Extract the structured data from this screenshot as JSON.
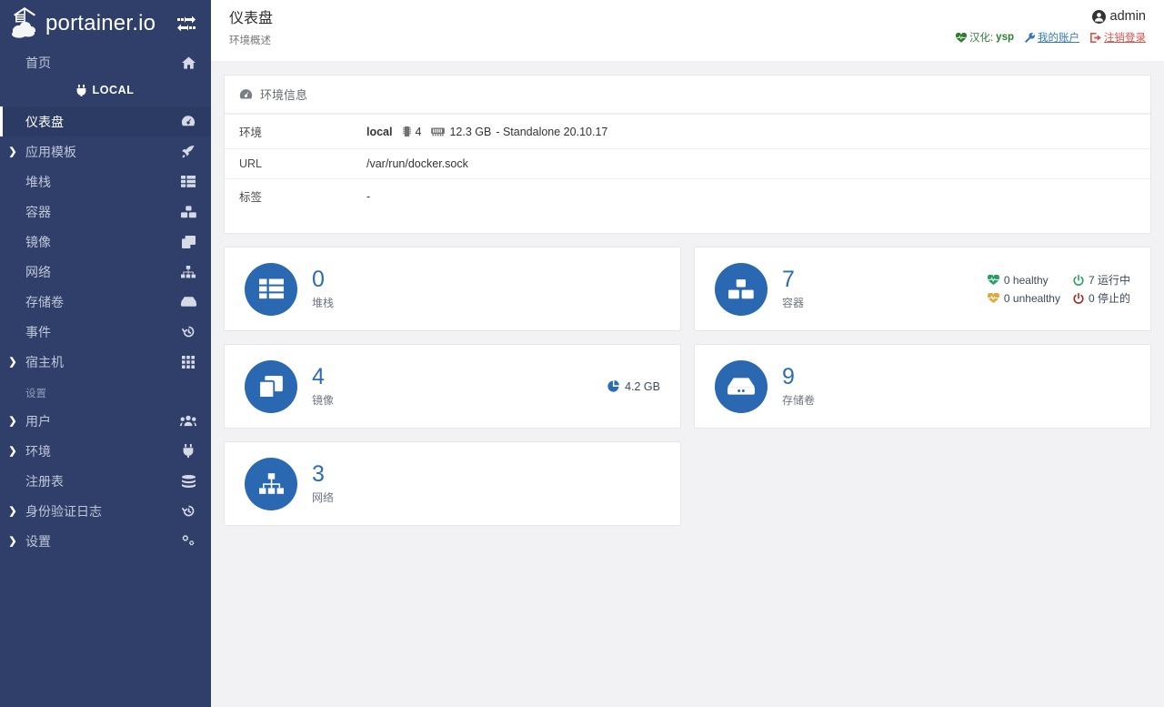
{
  "brand": {
    "name": "portainer.io",
    "logo_icon": "portainer-whale-logo",
    "toggle_icon": "collapse-sidebar-icon"
  },
  "sidebar": {
    "home": {
      "label": "首页",
      "icon": "home-icon"
    },
    "local": {
      "label": "LOCAL",
      "icon": "plug-icon"
    },
    "items": [
      {
        "label": "仪表盘",
        "icon": "dashboard-icon",
        "expandable": false,
        "active": true,
        "name": "dashboard"
      },
      {
        "label": "应用模板",
        "icon": "rocket-icon",
        "expandable": true,
        "active": false,
        "name": "app-templates"
      },
      {
        "label": "堆栈",
        "icon": "stacks-icon",
        "expandable": false,
        "active": false,
        "name": "stacks"
      },
      {
        "label": "容器",
        "icon": "containers-icon",
        "expandable": false,
        "active": false,
        "name": "containers"
      },
      {
        "label": "镜像",
        "icon": "images-icon",
        "expandable": false,
        "active": false,
        "name": "images"
      },
      {
        "label": "网络",
        "icon": "networks-icon",
        "expandable": false,
        "active": false,
        "name": "networks"
      },
      {
        "label": "存储卷",
        "icon": "volumes-icon",
        "expandable": false,
        "active": false,
        "name": "volumes"
      },
      {
        "label": "事件",
        "icon": "history-icon",
        "expandable": false,
        "active": false,
        "name": "events"
      },
      {
        "label": "宿主机",
        "icon": "grid-icon",
        "expandable": true,
        "active": false,
        "name": "host"
      }
    ],
    "settings_group_title": "设置",
    "settings_items": [
      {
        "label": "用户",
        "icon": "users-icon",
        "expandable": true,
        "name": "users"
      },
      {
        "label": "环境",
        "icon": "plug-icon",
        "expandable": true,
        "name": "environments"
      },
      {
        "label": "注册表",
        "icon": "database-icon",
        "expandable": false,
        "name": "registries"
      },
      {
        "label": "身份验证日志",
        "icon": "history-icon",
        "expandable": true,
        "name": "auth-logs"
      },
      {
        "label": "设置",
        "icon": "gears-icon",
        "expandable": true,
        "name": "settings"
      }
    ]
  },
  "header": {
    "title": "仪表盘",
    "subtitle": "环境概述",
    "user": "admin",
    "user_icon": "user-circle-icon",
    "translation_label": "汉化:",
    "translation_author": "ysp",
    "translation_icon": "heart-pulse-icon",
    "account_label": "我的账户",
    "account_icon": "wrench-icon",
    "logout_label": "注销登录",
    "logout_icon": "sign-out-icon"
  },
  "env_panel": {
    "icon": "dashboard-icon",
    "title": "环境信息",
    "rows": [
      {
        "key": "环境",
        "value": "local",
        "cpu_icon": "cpu-icon",
        "cpu": "4",
        "mem_icon": "memory-icon",
        "mem": "12.3 GB",
        "suffix": "- Standalone 20.10.17"
      },
      {
        "key": "URL",
        "value": "/var/run/docker.sock"
      },
      {
        "key": "标签",
        "value": "-"
      }
    ]
  },
  "cards": [
    {
      "name": "stacks-card",
      "icon": "stacks-icon",
      "count": "0",
      "label": "堆栈"
    },
    {
      "name": "containers-card",
      "icon": "containers-icon",
      "count": "7",
      "label": "容器",
      "stats": [
        {
          "icon": "heart-green-icon",
          "text": "0 healthy"
        },
        {
          "icon": "power-green-icon",
          "text": "7 运行中"
        },
        {
          "icon": "heart-orange-icon",
          "text": "0 unhealthy"
        },
        {
          "icon": "power-red-icon",
          "text": "0 停止的"
        }
      ]
    },
    {
      "name": "images-card",
      "icon": "images-icon",
      "count": "4",
      "label": "镜像",
      "size_icon": "pie-chart-icon",
      "size": "4.2 GB"
    },
    {
      "name": "volumes-card",
      "icon": "volumes-icon",
      "count": "9",
      "label": "存储卷"
    },
    {
      "name": "networks-card",
      "icon": "networks-icon",
      "count": "3",
      "label": "网络"
    }
  ],
  "colors": {
    "sidebar_bg": "#2f3f69",
    "sidebar_active_bg": "#2b3b63",
    "card_icon_bg": "#2a69b2",
    "card_number": "#2b6cb8",
    "page_bg": "#f2f2f4",
    "link_blue": "#337ab7",
    "logout_red": "#d9534f",
    "green": "#2e7d32",
    "orange": "#e0a93b"
  }
}
